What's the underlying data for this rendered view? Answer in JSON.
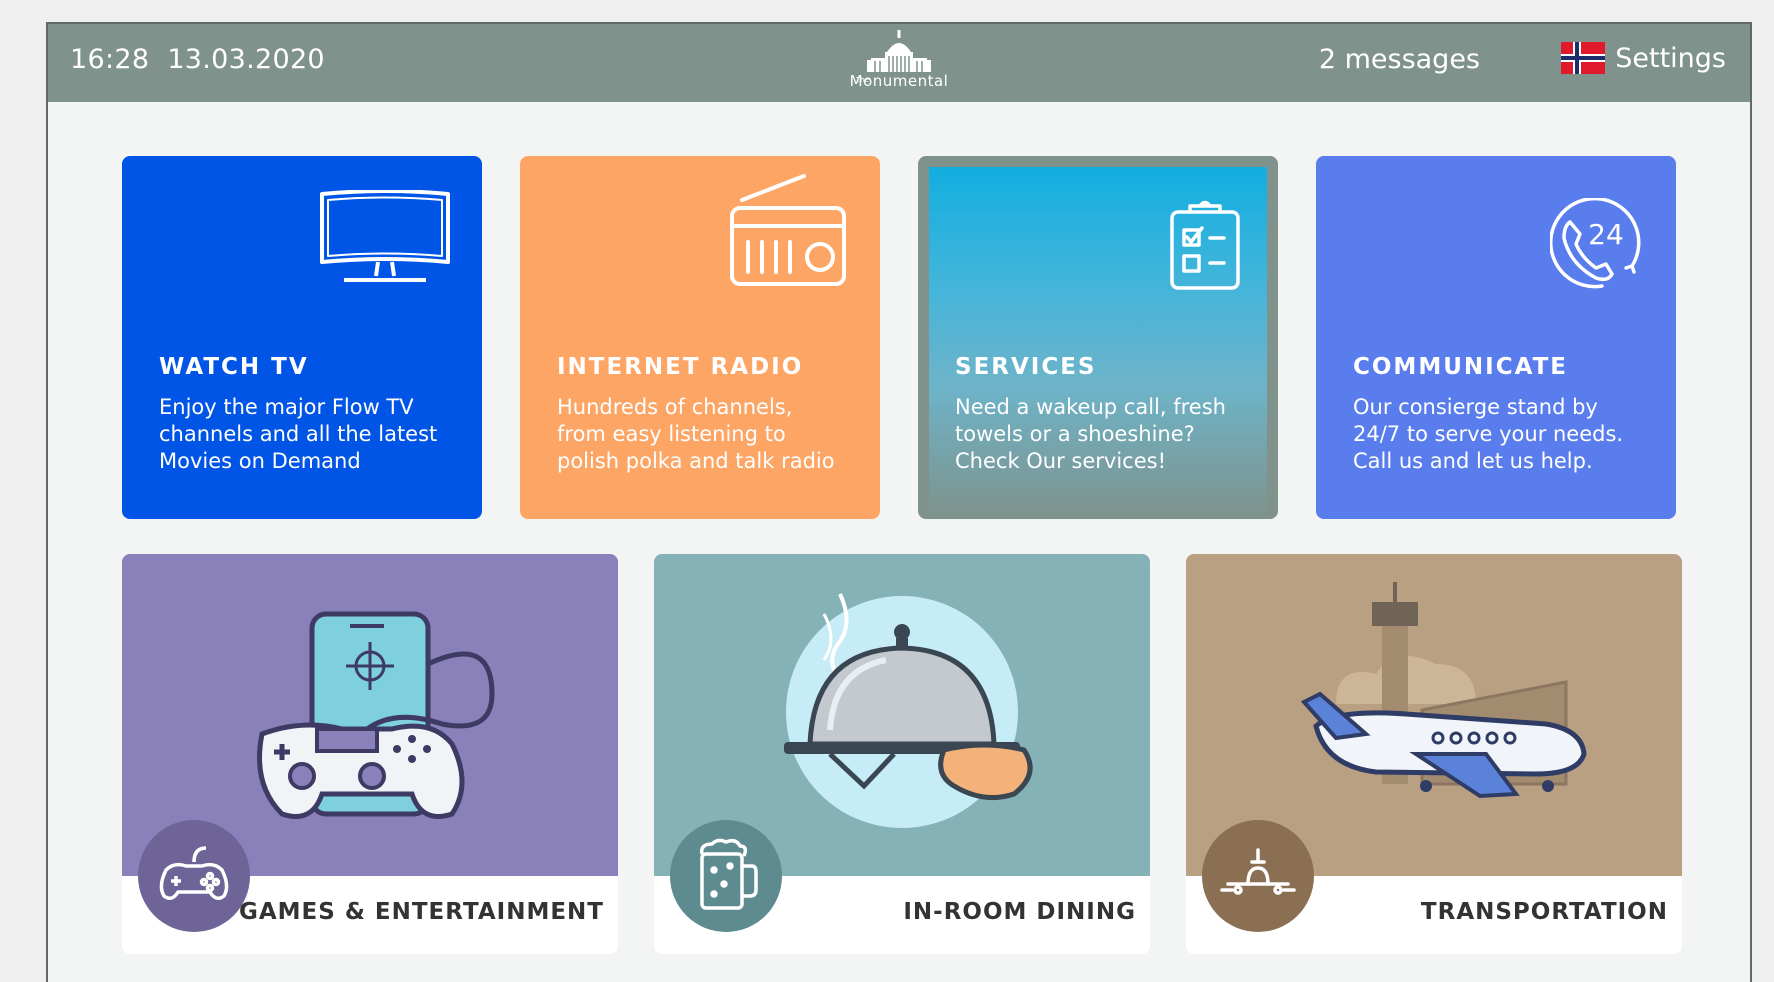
{
  "topbar": {
    "time": "16:28",
    "date": "13.03.2020",
    "logo_small": "The",
    "logo_name": "Monumental",
    "messages": "2 messages",
    "settings": "Settings",
    "flag_icon": "norway-flag-icon"
  },
  "tiles": [
    {
      "title": "WATCH TV",
      "desc": "Enjoy the major Flow TV\nchannels and all the latest\nMovies on Demand",
      "icon": "tv-icon",
      "color": "#0055e6"
    },
    {
      "title": "INTERNET RADIO",
      "desc": "Hundreds of channels,\nfrom easy listening to\npolish polka and talk radio",
      "icon": "radio-icon",
      "color": "#fda565"
    },
    {
      "title": "SERVICES",
      "desc": "Need a wakeup call, fresh\ntowels or a shoeshine?\nCheck Our services!",
      "icon": "clipboard-checklist-icon",
      "color": "#7f928b"
    },
    {
      "title": "COMMUNICATE",
      "desc": "Our consierge stand by\n24/7 to serve your needs.\nCall us and let us help.",
      "icon": "phone-24-icon",
      "color": "#5a7ded",
      "badge_text": "24"
    }
  ],
  "cards": [
    {
      "label": "GAMES & ENTERTAINMENT",
      "icon": "gamepad-icon",
      "illustration": "phone-and-gamepad-illustration",
      "color": "#8a81bb"
    },
    {
      "label": "IN-ROOM DINING",
      "icon": "beer-mug-icon",
      "illustration": "cloche-tray-illustration",
      "color": "#85b2b6"
    },
    {
      "label": "TRANSPORTATION",
      "icon": "plane-icon",
      "illustration": "airplane-airport-illustration",
      "color": "#b9a083"
    }
  ]
}
